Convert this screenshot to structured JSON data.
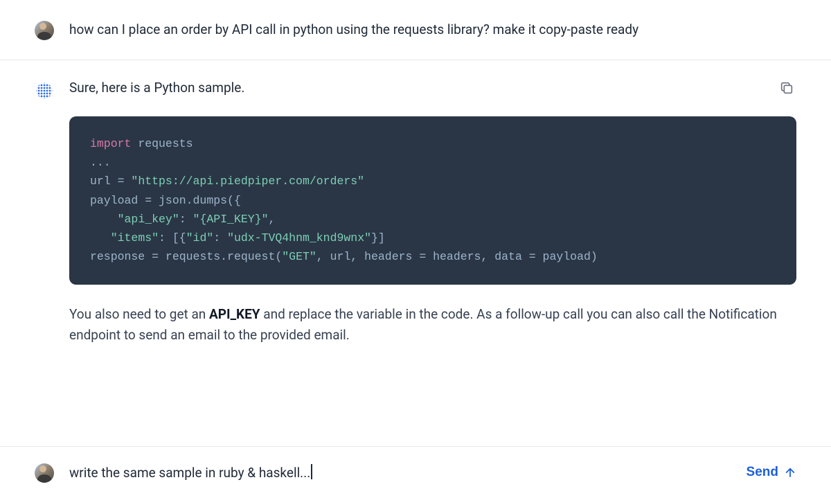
{
  "messages": {
    "user1": {
      "text": "how can I place an order by API call in python using the requests library? make it copy-paste ready"
    },
    "assistant1": {
      "intro": "Sure, here is a Python sample.",
      "code": {
        "line1_import": "import",
        "line1_module": " requests",
        "line2": "...",
        "line3_var": "url ",
        "line3_eq": "=",
        "line3_str": " \"https://api.piedpiper.com/orders\"",
        "line4_var": "payload ",
        "line4_eq": "=",
        "line4_rest": " json.dumps({",
        "line5_indent": "    ",
        "line5_key": "\"api_key\"",
        "line5_colon": ": ",
        "line5_val": "\"{API_KEY}\"",
        "line5_comma": ",",
        "line6_indent": "   ",
        "line6_key": "\"items\"",
        "line6_colon": ": [{",
        "line6_idkey": "\"id\"",
        "line6_colon2": ": ",
        "line6_idval": "\"udx-TVQ4hnm_knd9wnx\"",
        "line6_close": "}]",
        "line7_var": "response ",
        "line7_eq": "=",
        "line7_a": " requests.request(",
        "line7_get": "\"GET\"",
        "line7_b": ", url, headers ",
        "line7_eq2": "=",
        "line7_c": " headers, data ",
        "line7_eq3": "=",
        "line7_d": " payload)"
      },
      "outro_pre": "You also need to get an ",
      "outro_bold": "API_KEY",
      "outro_post": " and replace the variable in the code. As a follow-up call you can also call the Notification endpoint to send an email to the provided email."
    }
  },
  "composer": {
    "value": "write the same sample in ruby & haskell...",
    "send_label": "Send"
  },
  "icons": {
    "copy": "copy-icon",
    "send": "arrow-up-icon"
  }
}
